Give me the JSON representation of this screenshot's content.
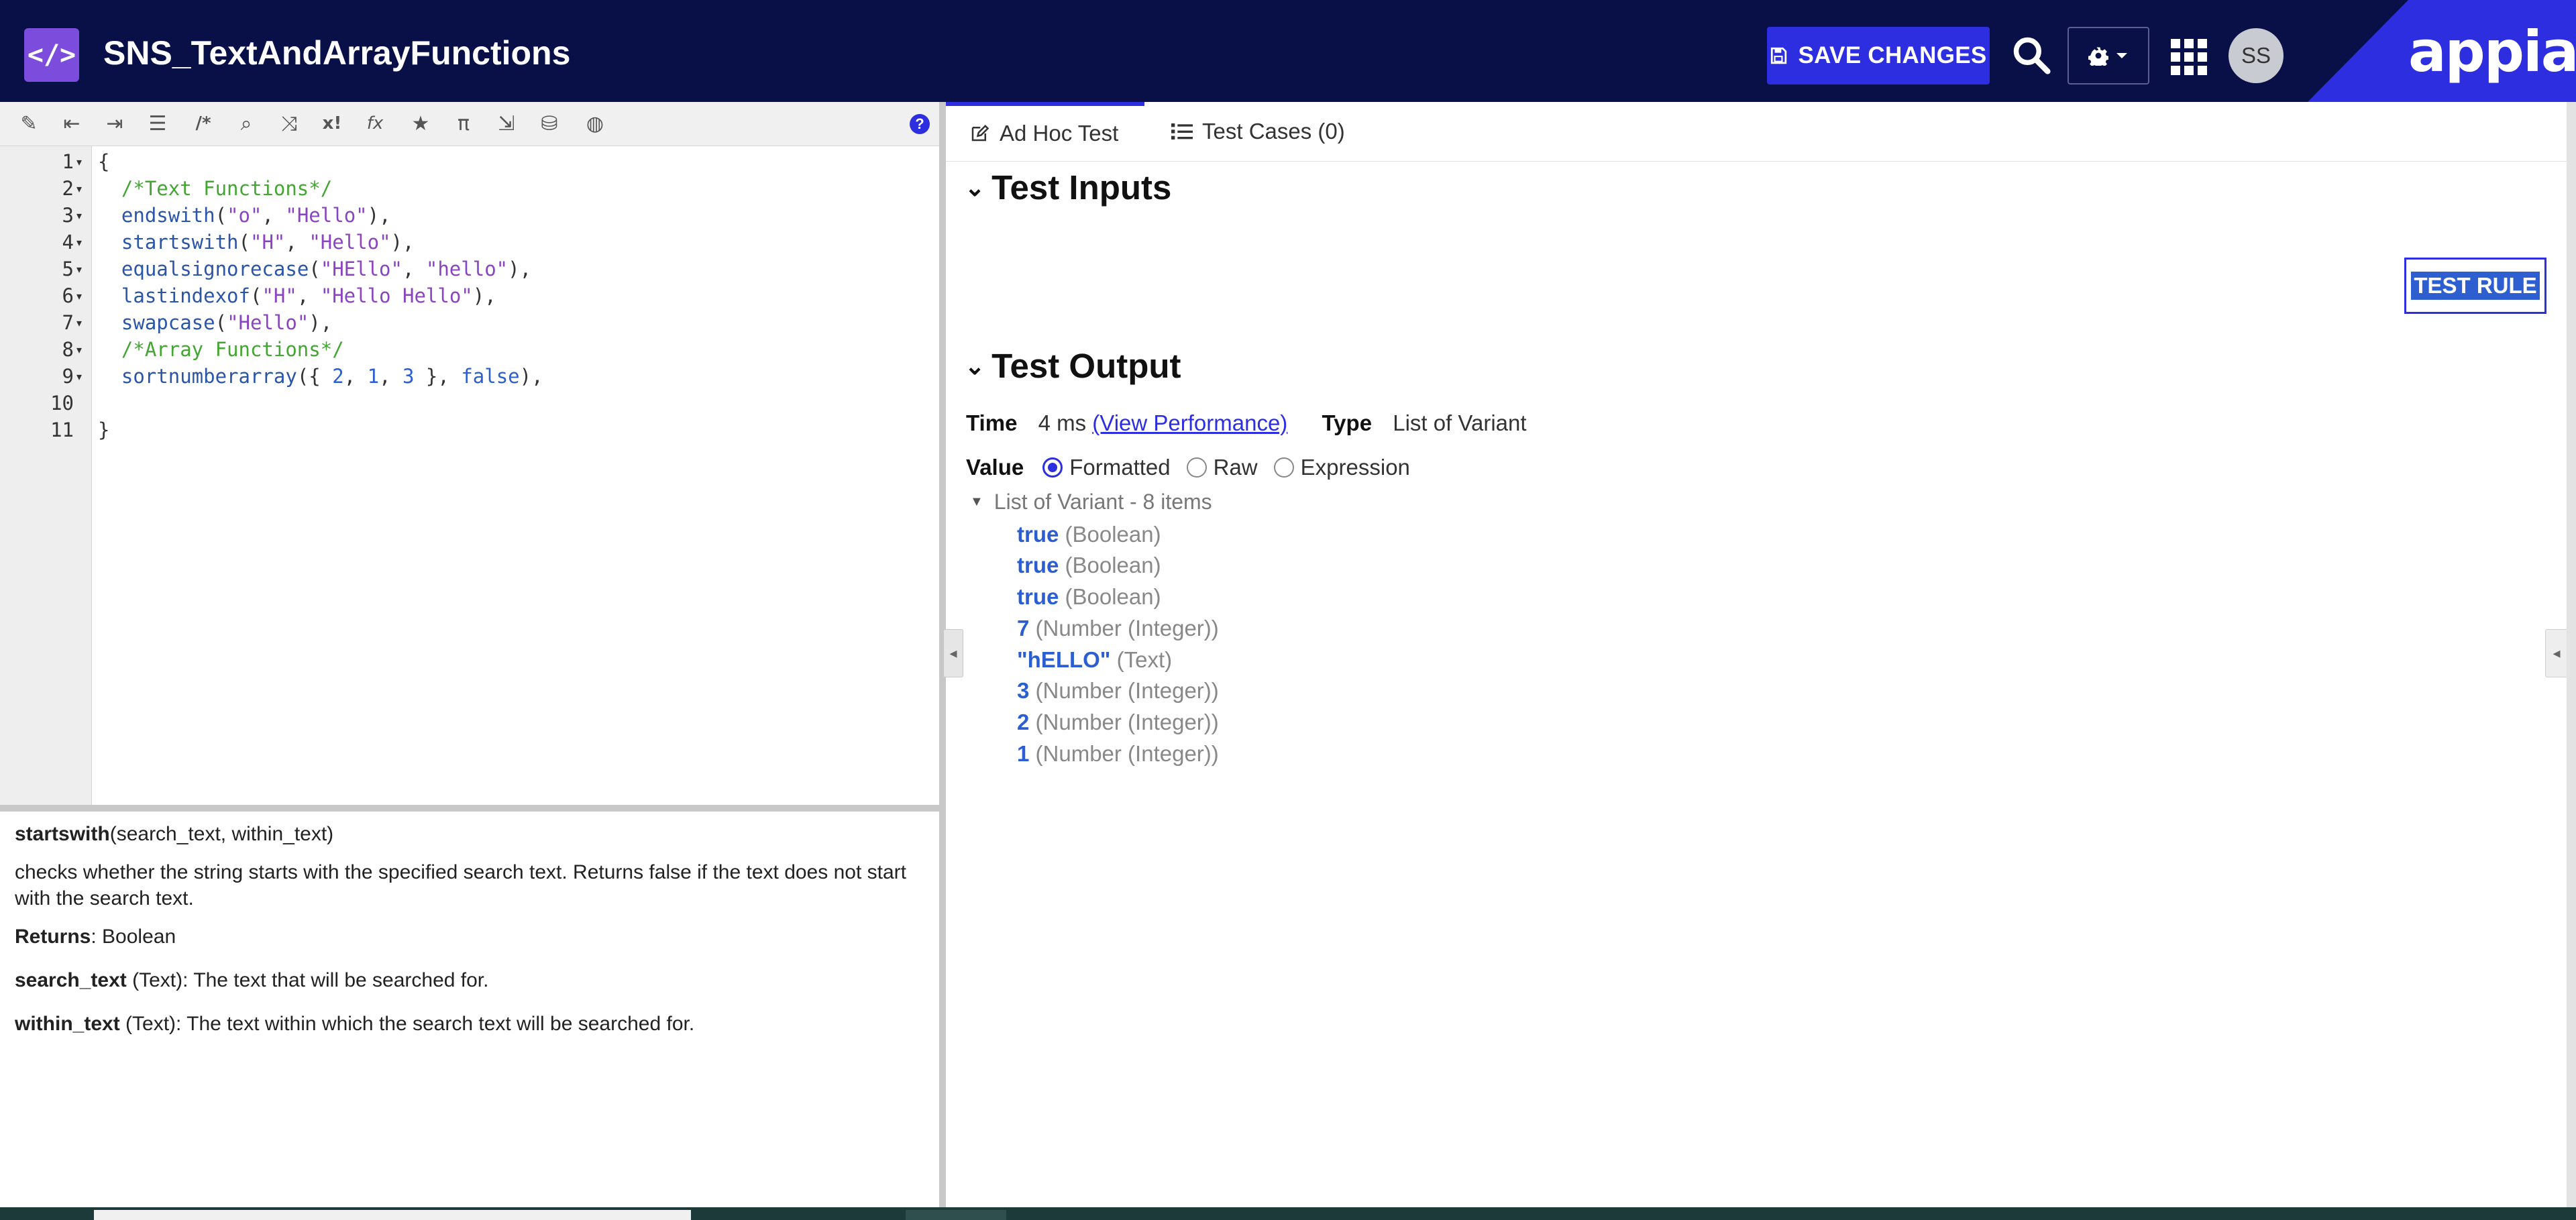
{
  "header": {
    "app_icon": "</>",
    "title": "SNS_TextAndArrayFunctions",
    "save_label": "SAVE CHANGES",
    "avatar_initials": "SS",
    "brand": "appian",
    "colors": {
      "header_bg": "#091048",
      "accent": "#2d2ee0",
      "app_icon_bg": "#7c4ddc"
    }
  },
  "toolbar": {
    "icons": [
      "magic-wand-icon",
      "outdent-icon",
      "indent-icon",
      "list-icon",
      "comment-icon",
      "search-icon",
      "shuffle-icon",
      "expression-icon",
      "function-icon",
      "star-icon",
      "pi-icon",
      "export-icon",
      "database-search-icon",
      "globe-icon"
    ],
    "glyphs": [
      "✎",
      "⇤",
      "⇥",
      "☰",
      "/*",
      "⌕",
      "⤨",
      "x!",
      "fx",
      "★",
      "π",
      "⇲",
      "⛁",
      "◍"
    ],
    "help": "?"
  },
  "editor": {
    "line_numbers": [
      "1",
      "2",
      "3",
      "4",
      "5",
      "6",
      "7",
      "8",
      "9",
      "10",
      "11"
    ],
    "lines": {
      "l1": {
        "a": "{"
      },
      "l2": {
        "a": "  /*Text Functions*/"
      },
      "l3": {
        "fn": "endswith",
        "a": "(",
        "s1": "\"o\"",
        "b": ", ",
        "s2": "\"Hello\"",
        "c": "),"
      },
      "l4": {
        "fn": "startswith",
        "a": "(",
        "s1": "\"H\"",
        "b": ", ",
        "s2": "\"Hello\"",
        "c": "),"
      },
      "l5": {
        "fn": "equalsignorecase",
        "a": "(",
        "s1": "\"HEllo\"",
        "b": ", ",
        "s2": "\"hello\"",
        "c": "),"
      },
      "l6": {
        "fn": "lastindexof",
        "a": "(",
        "s1": "\"H\"",
        "b": ", ",
        "s2": "\"Hello Hello\"",
        "c": "),"
      },
      "l7": {
        "fn": "swapcase",
        "a": "(",
        "s1": "\"Hello\"",
        "c": "),"
      },
      "l8": {
        "a": "  /*Array Functions*/"
      },
      "l9": {
        "fn": "sortnumberarray",
        "a": "({ ",
        "n1": "2",
        "b": ", ",
        "n2": "1",
        "c": ", ",
        "n3": "3",
        "d": " }, ",
        "kw": "false",
        "e": "),"
      },
      "l11": {
        "a": "}"
      }
    }
  },
  "doc": {
    "fn_name": "startswith",
    "signature": "(search_text, within_text)",
    "description": "checks whether the string starts with the specified search text. Returns false if the text does not start with the search text.",
    "returns_label": "Returns",
    "returns_value": ": Boolean",
    "params": [
      {
        "name": "search_text",
        "desc": " (Text): The text that will be searched for."
      },
      {
        "name": "within_text",
        "desc": " (Text): The text within which the search text will be searched for."
      }
    ]
  },
  "tabs": [
    {
      "label": "Ad Hoc Test",
      "active": true
    },
    {
      "label": "Test Cases (0)",
      "active": false
    }
  ],
  "test_inputs": {
    "title": "Test Inputs",
    "button": "TEST RULE"
  },
  "test_output": {
    "title": "Test Output",
    "time_label": "Time",
    "time_value": "4 ms",
    "perf_link": "(View Performance)",
    "type_label": "Type",
    "type_value": "List of Variant",
    "value_label": "Value",
    "radio_options": [
      "Formatted",
      "Raw",
      "Expression"
    ],
    "selected": "Formatted",
    "list_header": "List of Variant - 8 items",
    "items": [
      {
        "value": "true",
        "type": "(Boolean)"
      },
      {
        "value": "true",
        "type": "(Boolean)"
      },
      {
        "value": "true",
        "type": "(Boolean)"
      },
      {
        "value": "7",
        "type": "(Number (Integer))"
      },
      {
        "value": "\"hELLO\"",
        "type": "(Text)"
      },
      {
        "value": "3",
        "type": "(Number (Integer))"
      },
      {
        "value": "2",
        "type": "(Number (Integer))"
      },
      {
        "value": "1",
        "type": "(Number (Integer))"
      }
    ]
  }
}
